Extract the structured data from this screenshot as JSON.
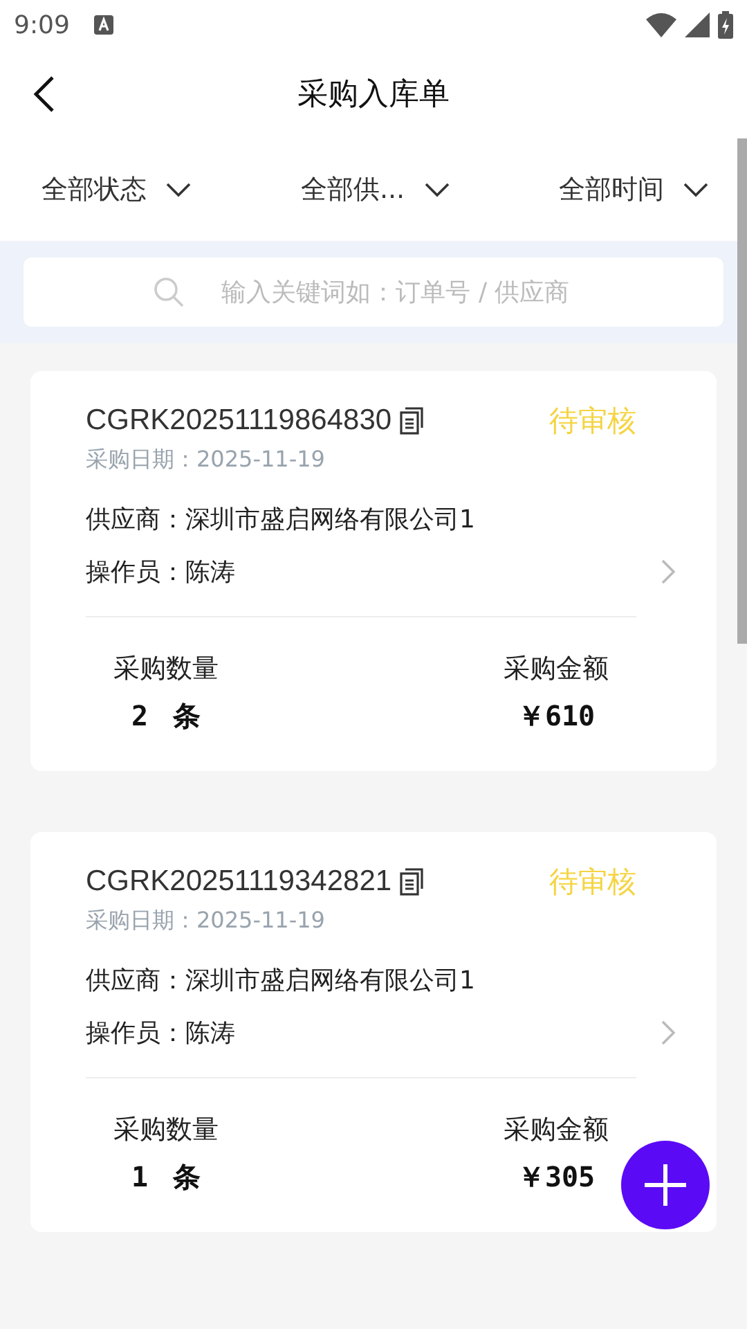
{
  "status_bar": {
    "time": "9:09"
  },
  "header": {
    "title": "采购入库单"
  },
  "filters": [
    {
      "label": "全部状态"
    },
    {
      "label": "全部供..."
    },
    {
      "label": "全部时间"
    }
  ],
  "search": {
    "placeholder": "输入关键词如：订单号 / 供应商"
  },
  "orders": [
    {
      "code": "CGRK20251119864830",
      "status": "待审核",
      "date_label": "采购日期：",
      "date": "2025-11-19",
      "supplier_label": "供应商：",
      "supplier": "深圳市盛启网络有限公司1",
      "operator_label": "操作员：",
      "operator": "陈涛",
      "qty_label": "采购数量",
      "qty": "2 条",
      "amount_label": "采购金额",
      "amount": "￥610"
    },
    {
      "code": "CGRK20251119342821",
      "status": "待审核",
      "date_label": "采购日期：",
      "date": "2025-11-19",
      "supplier_label": "供应商：",
      "supplier": "深圳市盛启网络有限公司1",
      "operator_label": "操作员：",
      "operator": "陈涛",
      "qty_label": "采购数量",
      "qty": "1 条",
      "amount_label": "采购金额",
      "amount": "￥305"
    }
  ]
}
